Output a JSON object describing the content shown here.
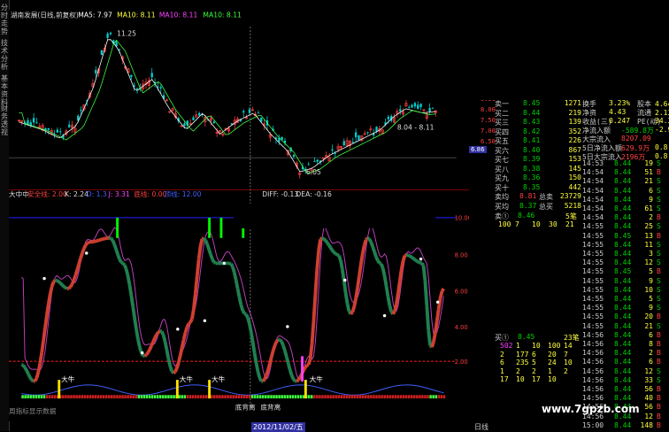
{
  "sidebar": {
    "tabs": [
      "分时走势",
      "技术分析",
      "基本资料",
      "财务透视"
    ]
  },
  "header": {
    "stock_title": "湖南发展(日线,前复权)",
    "ma5": "MA5: 7.97",
    "ma10a": "MA10: 8.11",
    "ma10b": "MA10: 8.11",
    "ma10c": "MA10: 8.11"
  },
  "price_annotations": {
    "high": "11.25",
    "low": "6.05",
    "recent_range": "8.04 - 8.11",
    "last_price_tag": "6.86"
  },
  "indicator_header": {
    "name": "大中中",
    "safe_line": "安全线: 2.00",
    "k": "K: 2.24",
    "d": "D: 1.3",
    "j": "J: 3.31",
    "trend": "底线: 0.00",
    "xx": "顶线: 12.00",
    "diff": "DIFF: -0.13",
    "dea": "DEA: -0.16"
  },
  "indicator_axis": [
    "10.00",
    "8.00",
    "6.00",
    "4.00",
    "2.00"
  ],
  "price_axis": [
    "8.50",
    "8.00",
    "7.50",
    "7.00",
    "6.50"
  ],
  "signals": {
    "bull_label": "大牛",
    "bottom_label1": "底背离",
    "bottom_label2": "底背离",
    "bottom_tab": "周指标显示数据"
  },
  "date_marker": "2012/11/02/五",
  "day_tab": "日线",
  "quote_panel": {
    "stats": [
      {
        "label": "换手",
        "value": "3.23%",
        "label2": "股本",
        "value2": "4.64亿"
      },
      {
        "label": "净资",
        "value": "4.43",
        "label2": "流通",
        "value2": "2.13亿"
      },
      {
        "label": "收益(三)",
        "value": "0.247",
        "label2": "PE(动)",
        "value2": "34.3"
      },
      {
        "label": "净流入额",
        "value": "-589.8万",
        "label2": "",
        "value2": "-2.9"
      },
      {
        "label": "大宗流入",
        "value": "8207.09",
        "label2": "",
        "value2": ""
      },
      {
        "label": "5日净流入额",
        "value": "629.9万",
        "label2": "",
        "value2": "0.8"
      },
      {
        "label": "5日大宗流入",
        "value": "2196万",
        "label2": "",
        "value2": "0.8"
      }
    ],
    "sells": [
      {
        "label": "卖一",
        "price": "8.45",
        "vol": "1271"
      },
      {
        "label": "买二",
        "price": "8.44",
        "vol": "219"
      },
      {
        "label": "买三",
        "price": "8.43",
        "vol": "139"
      },
      {
        "label": "买四",
        "price": "8.42",
        "vol": "352"
      },
      {
        "label": "买五",
        "price": "8.41",
        "vol": "226"
      },
      {
        "label": "买六",
        "price": "8.40",
        "vol": "867"
      },
      {
        "label": "买七",
        "price": "8.39",
        "vol": "153"
      },
      {
        "label": "买八",
        "price": "8.38",
        "vol": "145"
      },
      {
        "label": "买九",
        "price": "8.36",
        "vol": "150"
      },
      {
        "label": "买十",
        "price": "8.35",
        "vol": "442"
      }
    ],
    "totals": [
      {
        "label": "卖均",
        "price": "8.81",
        "label2": "总卖",
        "vol": "23729"
      },
      {
        "label": "买均",
        "price": "8.37",
        "label2": "总买",
        "vol": "5218"
      }
    ],
    "sell1": {
      "label": "卖①",
      "price": "8.46",
      "vol": "5笔"
    },
    "sell1_detail": [
      "100",
      "7",
      "10",
      "30",
      "21"
    ],
    "buy1": {
      "label": "买①",
      "price": "8.45",
      "vol": "23笔"
    },
    "buy1_detail": [
      [
        "502",
        "1",
        "10",
        "100",
        "14"
      ],
      [
        "2",
        "177",
        "6",
        "20",
        "7"
      ],
      [
        "6",
        "235",
        "5",
        "24",
        "10"
      ],
      [
        "1",
        "2",
        "2",
        "1",
        "2"
      ],
      [
        "17",
        "10",
        "17",
        "10",
        ""
      ]
    ]
  },
  "ticks": [
    {
      "time": "14:53",
      "price": "8.44",
      "vol": "19",
      "side": "S"
    },
    {
      "time": "14:54",
      "price": "8.44",
      "vol": "51",
      "side": "B"
    },
    {
      "time": "14:54",
      "price": "8.44",
      "vol": "21",
      "side": "S"
    },
    {
      "time": "14:54",
      "price": "8.44",
      "vol": "6",
      "side": "S"
    },
    {
      "time": "14:54",
      "price": "8.44",
      "vol": "9",
      "side": "S"
    },
    {
      "time": "14:54",
      "price": "8.44",
      "vol": "61",
      "side": "S"
    },
    {
      "time": "14:54",
      "price": "8.44",
      "vol": "2",
      "side": "B"
    },
    {
      "time": "14:55",
      "price": "8.44",
      "vol": "25",
      "side": "S"
    },
    {
      "time": "14:55",
      "price": "8.45",
      "vol": "13",
      "side": "B"
    },
    {
      "time": "14:55",
      "price": "8.44",
      "vol": "11",
      "side": "S"
    },
    {
      "time": "14:55",
      "price": "8.44",
      "vol": "3",
      "side": "S"
    },
    {
      "time": "14:55",
      "price": "8.44",
      "vol": "12",
      "side": "S"
    },
    {
      "time": "14:55",
      "price": "8.45",
      "vol": "5",
      "side": "B"
    },
    {
      "time": "14:55",
      "price": "8.44",
      "vol": "9",
      "side": "S"
    },
    {
      "time": "14:55",
      "price": "8.44",
      "vol": "10",
      "side": "S"
    },
    {
      "time": "14:55",
      "price": "8.44",
      "vol": "5",
      "side": "S"
    },
    {
      "time": "14:55",
      "price": "8.44",
      "vol": "9",
      "side": "S"
    },
    {
      "time": "14:55",
      "price": "8.44",
      "vol": "20",
      "side": "B"
    },
    {
      "time": "14:55",
      "price": "8.44",
      "vol": "21",
      "side": "S"
    },
    {
      "time": "14:56",
      "price": "8.44",
      "vol": "6",
      "side": "B"
    },
    {
      "time": "14:56",
      "price": "8.44",
      "vol": "8",
      "side": "B"
    },
    {
      "time": "14:56",
      "price": "8.44",
      "vol": "2",
      "side": "B"
    },
    {
      "time": "14:56",
      "price": "8.44",
      "vol": "6",
      "side": "B"
    },
    {
      "time": "14:56",
      "price": "8.44",
      "vol": "12",
      "side": "S"
    },
    {
      "time": "14:56",
      "price": "8.44",
      "vol": "33",
      "side": "S"
    },
    {
      "time": "14:56",
      "price": "8.44",
      "vol": "56",
      "side": "B"
    },
    {
      "time": "14:56",
      "price": "8.44",
      "vol": "40",
      "side": "B"
    },
    {
      "time": "14:56",
      "price": "8.44",
      "vol": "56",
      "side": "B"
    },
    {
      "time": "14:56",
      "price": "8.44",
      "vol": "12",
      "side": "B"
    },
    {
      "time": "15:00",
      "price": "8.44",
      "vol": "148",
      "side": "B"
    }
  ],
  "watermark": "www.7gpzb.com",
  "colors": {
    "up": "#ff4040",
    "down": "#00d0d0",
    "ma5": "#ffffff",
    "ma10": "#ffff40",
    "ma20": "#ff40ff",
    "ma30": "#40ff40"
  }
}
